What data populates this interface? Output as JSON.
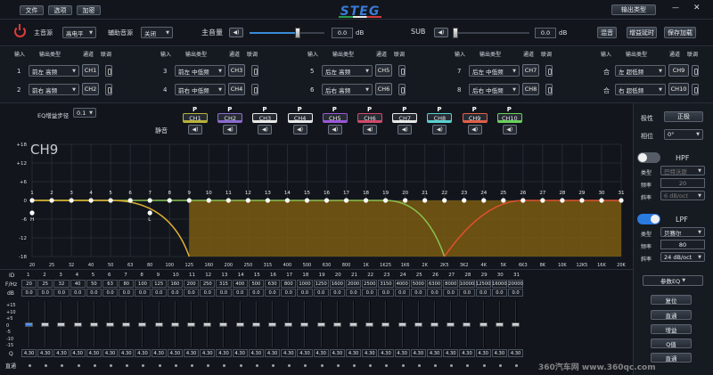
{
  "topbar": {
    "menu": [
      "文件",
      "选项",
      "加密"
    ],
    "brand": "STEG",
    "output_type_label": "输出类型",
    "min_label": "—",
    "close_label": "✕"
  },
  "row2": {
    "main_source_label": "主音源",
    "main_source_value": "高电平",
    "aux_source_label": "辅助音源",
    "aux_source_value": "关闭",
    "master_volume_label": "主音量",
    "master_volume_value": "0.0",
    "master_volume_unit": "dB",
    "master_volume_level": 0.64,
    "sub_label": "SUB",
    "sub_value": "0.0",
    "sub_unit": "dB",
    "sub_level": 0.01,
    "mix_label": "混音",
    "gain_delay_label": "增益延时",
    "save_load_label": "保存加载"
  },
  "routing": {
    "col_input": "输入",
    "col_output_type": "输出类型",
    "col_channel": "通道",
    "col_link": "联调",
    "groups": [
      {
        "rows": [
          {
            "n": "1",
            "type": "前左 高频",
            "ch": "CH1"
          },
          {
            "n": "2",
            "type": "前右 高频",
            "ch": "CH2"
          }
        ]
      },
      {
        "rows": [
          {
            "n": "3",
            "type": "前左 中低频",
            "ch": "CH3"
          },
          {
            "n": "4",
            "type": "前右 中低频",
            "ch": "CH4"
          }
        ]
      },
      {
        "rows": [
          {
            "n": "5",
            "type": "后左 高频",
            "ch": "CH5"
          },
          {
            "n": "6",
            "type": "后右 高频",
            "ch": "CH6"
          }
        ]
      },
      {
        "rows": [
          {
            "n": "7",
            "type": "后左 中低频",
            "ch": "CH7"
          },
          {
            "n": "8",
            "type": "后右 中低频",
            "ch": "CH8"
          }
        ]
      },
      {
        "rows": [
          {
            "n": "合",
            "type": "左 超低频",
            "ch": "CH9"
          },
          {
            "n": "合",
            "type": "右 超低频",
            "ch": "CH10"
          }
        ]
      }
    ]
  },
  "eq_step": {
    "label": "EQ增益步径",
    "value": "0.1"
  },
  "mute": {
    "label": "静音",
    "p_label": "P",
    "channels": [
      {
        "name": "CH1",
        "color": "#b8b23a"
      },
      {
        "name": "CH2",
        "color": "#8a6ad0"
      },
      {
        "name": "CH3",
        "color": "#e8e8e8"
      },
      {
        "name": "CH4",
        "color": "#e8e8e8"
      },
      {
        "name": "CH5",
        "color": "#9a58d8"
      },
      {
        "name": "CH6",
        "color": "#d04a6a"
      },
      {
        "name": "CH7",
        "color": "#e8e8e8"
      },
      {
        "name": "CH8",
        "color": "#5ad0d0"
      },
      {
        "name": "CH9",
        "color": "#e0604a"
      },
      {
        "name": "CH10",
        "color": "#6ad05a"
      }
    ]
  },
  "graph": {
    "channel_label": "CH9",
    "y_ticks": [
      "+18",
      "+12",
      "+6",
      "0",
      "-6",
      "-12",
      "-18"
    ],
    "x_ticks": [
      "20",
      "25",
      "32",
      "40",
      "50",
      "63",
      "80",
      "100",
      "125",
      "160",
      "200",
      "250",
      "315",
      "400",
      "500",
      "630",
      "800",
      "1K",
      "1K25",
      "1K6",
      "2K",
      "2K5",
      "3K2",
      "4K",
      "5K",
      "6K3",
      "8K",
      "10K",
      "12K5",
      "16K",
      "20K"
    ],
    "band_numbers": [
      "1",
      "2",
      "3",
      "4",
      "5",
      "6",
      "7",
      "8",
      "9",
      "10",
      "11",
      "12",
      "13",
      "14",
      "15",
      "16",
      "17",
      "18",
      "19",
      "20",
      "21",
      "22",
      "23",
      "24",
      "25",
      "26",
      "27",
      "28",
      "29",
      "30",
      "31"
    ],
    "hp_marker": "H",
    "lp_marker": "L",
    "colors": {
      "grid": "#2a3038",
      "fill": "#7a5a10",
      "lpf_curve": "#e0b030",
      "hpf_curve": "#e05030",
      "flat_curve": "#8ac050"
    }
  },
  "right_panel": {
    "polarity_label": "极性",
    "polarity_value": "正极",
    "phase_label": "相位",
    "phase_value": "0°",
    "hpf_label": "HPF",
    "hpf_enabled": false,
    "hpf_type_label": "类型",
    "hpf_type_value": "巴特沃斯",
    "hpf_freq_label": "频率",
    "hpf_freq_value": "20",
    "hpf_slope_label": "斜率",
    "hpf_slope_value": "6 dB/oct",
    "lpf_label": "LPF",
    "lpf_enabled": true,
    "lpf_type_label": "类型",
    "lpf_type_value": "贝赛尔",
    "lpf_freq_label": "频率",
    "lpf_freq_value": "80",
    "lpf_slope_label": "斜率",
    "lpf_slope_value": "24 dB/oct",
    "eq_mode_value": "参数EQ",
    "btn_reset": "复位",
    "btn_bypass": "直通",
    "btn_gain": "增益",
    "btn_q": "Q值",
    "btn_straight": "直通"
  },
  "eq_table": {
    "id_label": "ID",
    "freq_label": "F/Hz",
    "db_label": "dB",
    "q_label": "Q",
    "bypass_label": "直通",
    "ids": [
      "1",
      "2",
      "3",
      "4",
      "5",
      "6",
      "7",
      "8",
      "9",
      "10",
      "11",
      "12",
      "13",
      "14",
      "15",
      "16",
      "17",
      "18",
      "19",
      "20",
      "21",
      "22",
      "23",
      "24",
      "25",
      "26",
      "27",
      "28",
      "29",
      "30",
      "31"
    ],
    "freqs": [
      "20",
      "25",
      "32",
      "40",
      "50",
      "63",
      "80",
      "100",
      "125",
      "160",
      "200",
      "250",
      "315",
      "400",
      "500",
      "630",
      "800",
      "1000",
      "1250",
      "1600",
      "2000",
      "2500",
      "3150",
      "4000",
      "5000",
      "6300",
      "8000",
      "10000",
      "12500",
      "16000",
      "20000"
    ],
    "dbs": [
      "0.0",
      "0.0",
      "0.0",
      "0.0",
      "0.0",
      "0.0",
      "0.0",
      "0.0",
      "0.0",
      "0.0",
      "0.0",
      "0.0",
      "0.0",
      "0.0",
      "0.0",
      "0.0",
      "0.0",
      "0.0",
      "0.0",
      "0.0",
      "0.0",
      "0.0",
      "0.0",
      "0.0",
      "0.0",
      "0.0",
      "0.0",
      "0.0",
      "0.0",
      "0.0",
      "0.0"
    ],
    "qs": [
      "4.30",
      "4.30",
      "4.30",
      "4.30",
      "4.30",
      "4.30",
      "4.30",
      "4.30",
      "4.30",
      "4.30",
      "4.30",
      "4.30",
      "4.30",
      "4.30",
      "4.30",
      "4.30",
      "4.30",
      "4.30",
      "4.30",
      "4.30",
      "4.30",
      "4.30",
      "4.30",
      "4.30",
      "4.30",
      "4.30",
      "4.30",
      "4.30",
      "4.30",
      "4.30",
      "4.30"
    ],
    "scale": [
      "+15",
      "+10",
      "+5",
      "0",
      "-5",
      "-10",
      "-15"
    ],
    "gain_levels": [
      0.5,
      0.5,
      0.5,
      0.5,
      0.5,
      0.5,
      0.5,
      0.5,
      0.5,
      0.5,
      0.5,
      0.5,
      0.5,
      0.5,
      0.5,
      0.5,
      0.5,
      0.5,
      0.5,
      0.5,
      0.5,
      0.5,
      0.5,
      0.5,
      0.5,
      0.5,
      0.5,
      0.5,
      0.5,
      0.5,
      0.5
    ]
  },
  "watermark": "360汽车网 www.360qc.com"
}
